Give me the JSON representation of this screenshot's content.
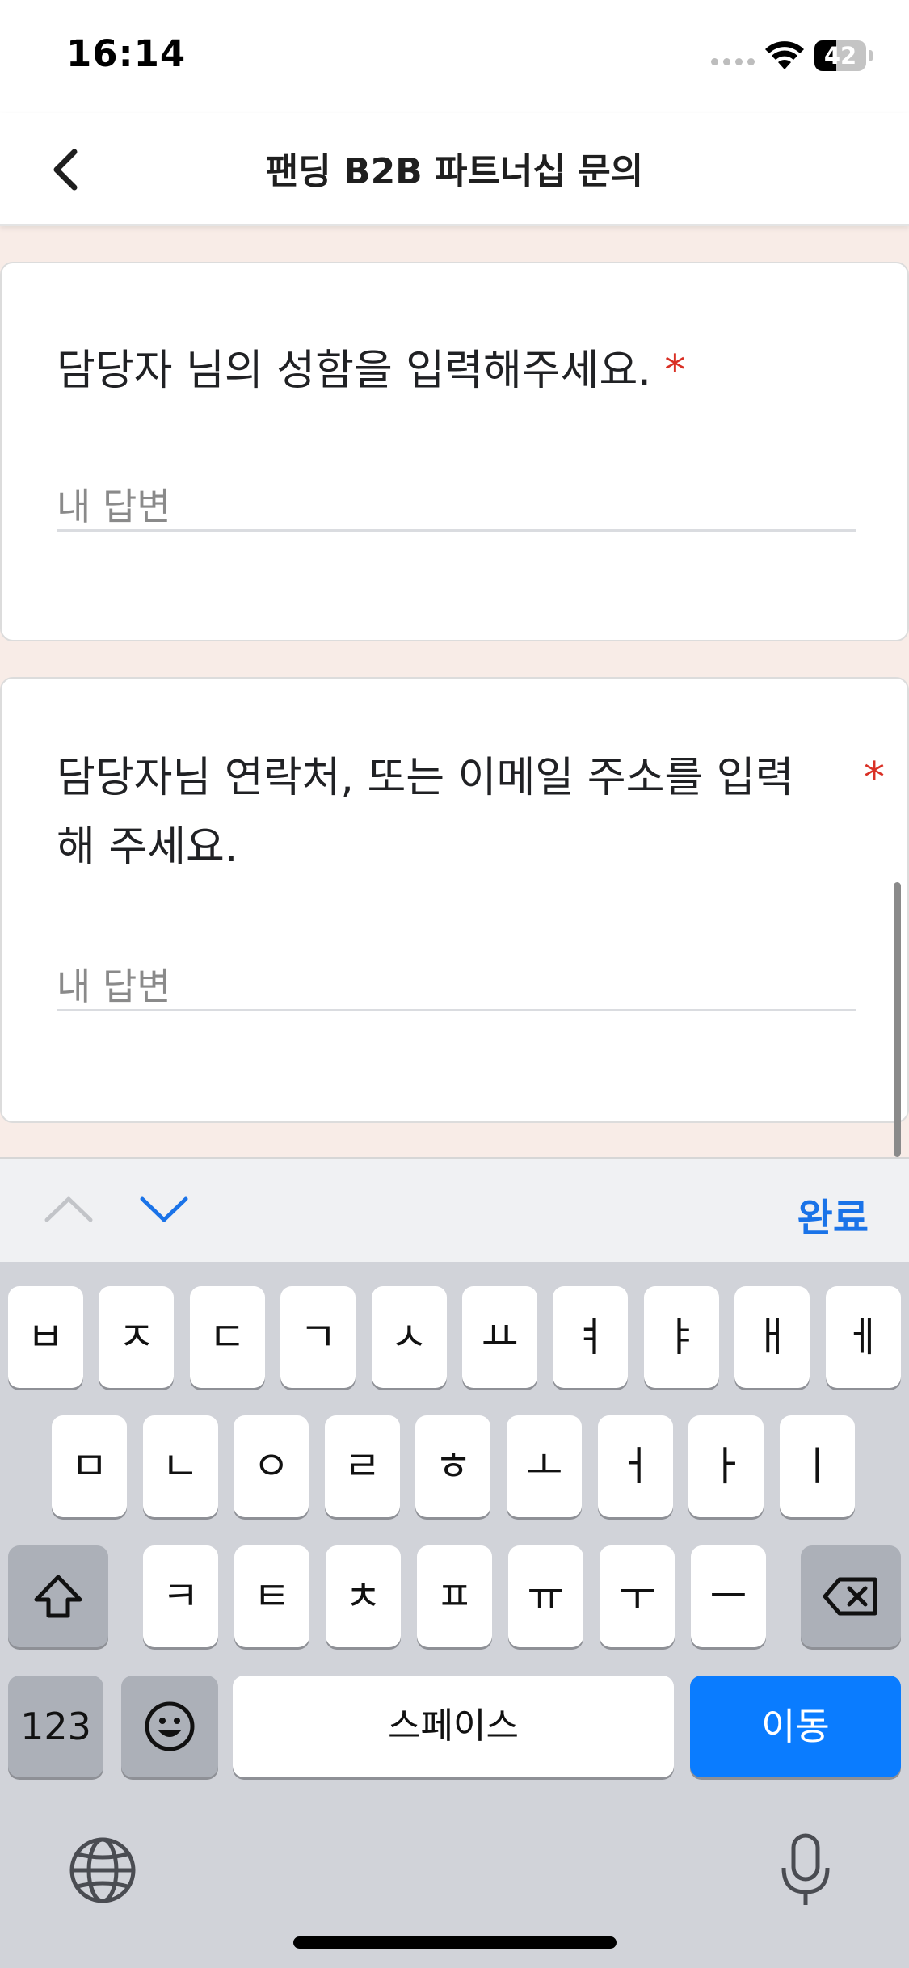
{
  "status_bar": {
    "time": "16:14",
    "battery_level": "42"
  },
  "header": {
    "title": "팬딩 B2B 파트너십 문의"
  },
  "form": {
    "questions": [
      {
        "label": "담당자 님의 성함을 입력해주세요.",
        "required_mark": "*",
        "placeholder": "내 답변"
      },
      {
        "label": "담당자님 연락처, 또는 이메일 주소를 입력해 주세요.",
        "required_mark": "*",
        "placeholder": "내 답변"
      }
    ]
  },
  "accessory_bar": {
    "done_label": "완료"
  },
  "keyboard": {
    "row1": [
      "ㅂ",
      "ㅈ",
      "ㄷ",
      "ㄱ",
      "ㅅ",
      "ㅛ",
      "ㅕ",
      "ㅑ",
      "ㅐ",
      "ㅔ"
    ],
    "row2": [
      "ㅁ",
      "ㄴ",
      "ㅇ",
      "ㄹ",
      "ㅎ",
      "ㅗ",
      "ㅓ",
      "ㅏ",
      "ㅣ"
    ],
    "row3": [
      "ㅋ",
      "ㅌ",
      "ㅊ",
      "ㅍ",
      "ㅠ",
      "ㅜ",
      "ㅡ"
    ],
    "numbers_label": "123",
    "space_label": "스페이스",
    "go_label": "이동"
  },
  "colors": {
    "accent": "#1a73e8",
    "required": "#d93025",
    "go_key": "#0a7cff",
    "page_bg": "#f8ece7"
  },
  "icons": [
    "back-icon",
    "wifi-icon",
    "chevron-up-icon",
    "chevron-down-icon",
    "shift-icon",
    "delete-icon",
    "emoji-icon",
    "globe-icon",
    "microphone-icon"
  ]
}
